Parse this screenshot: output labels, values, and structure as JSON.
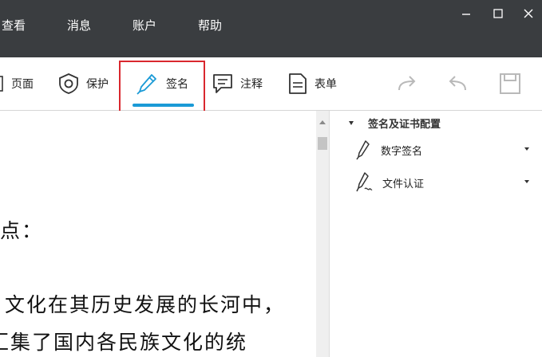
{
  "menu": {
    "items": [
      "查看",
      "消息",
      "账户",
      "帮助"
    ]
  },
  "window_controls": {
    "minimize": "minimize-icon",
    "maximize": "maximize-icon",
    "close": "close-icon"
  },
  "toolbar": {
    "page_label": "页面",
    "protect_label": "保护",
    "sign_label": "签名",
    "comment_label": "注释",
    "form_label": "表单"
  },
  "colors": {
    "titlebar": "#3a3d40",
    "accent": "#1a9ad6",
    "highlight": "#d9272e"
  },
  "document": {
    "lines": [
      "点：",
      "文化在其历史发展的长河中，",
      "汇集了国内各民族文化的统"
    ]
  },
  "panel": {
    "header": "签名及证书配置",
    "items": [
      {
        "label": "数字签名",
        "icon": "pen-icon"
      },
      {
        "label": "文件认证",
        "icon": "pen-certify-icon"
      }
    ]
  }
}
